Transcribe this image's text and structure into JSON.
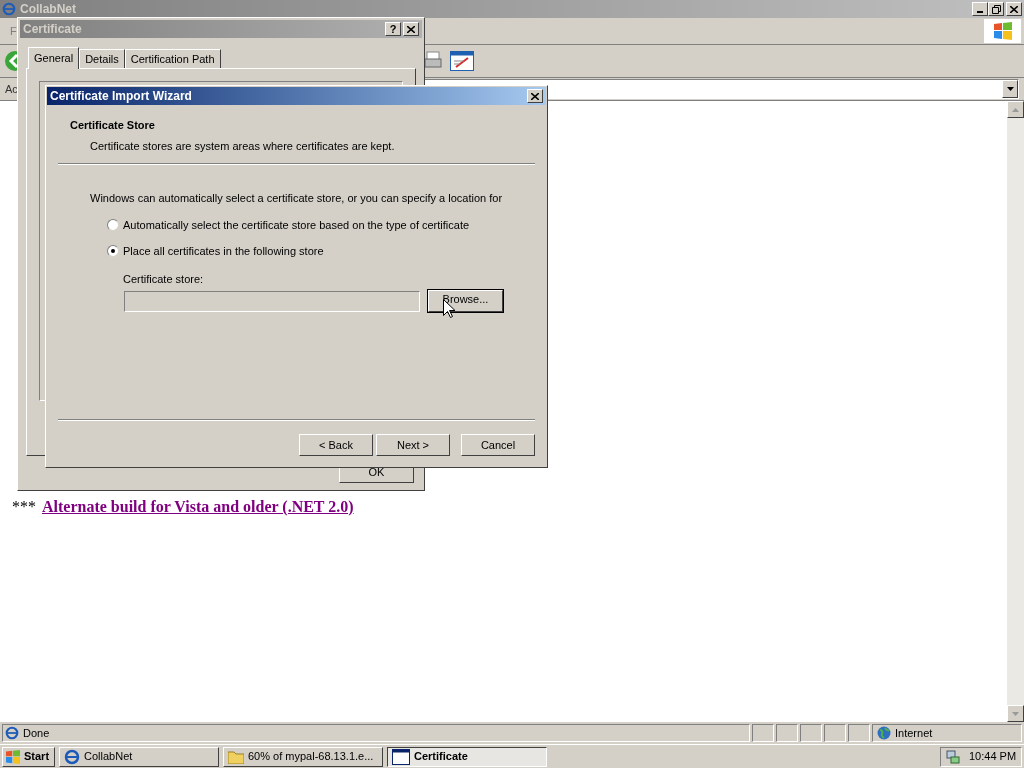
{
  "browser": {
    "title": "CollabNet",
    "menu_fragment": "F",
    "address_label": "Ac",
    "page": {
      "prefix": "***",
      "link": "Alternate build for Vista and older (.NET 2.0)"
    },
    "status": {
      "text": "Done",
      "zone": "Internet"
    }
  },
  "certificate_dialog": {
    "title": "Certificate",
    "help_button": "?",
    "tabs": [
      {
        "label": "General",
        "selected": true
      },
      {
        "label": "Details",
        "selected": false
      },
      {
        "label": "Certification Path",
        "selected": false
      }
    ],
    "ok_button": "OK"
  },
  "wizard": {
    "title": "Certificate Import Wizard",
    "heading": "Certificate Store",
    "subheading": "Certificate stores are system areas where certificates are kept.",
    "intro": "Windows can automatically select a certificate store, or you can specify a location for",
    "options": [
      {
        "label": "Automatically select the certificate store based on the type of certificate",
        "selected": false
      },
      {
        "label": "Place all certificates in the following store",
        "selected": true
      }
    ],
    "store_label": "Certificate store:",
    "store_field": {
      "disabled": true
    },
    "browse_button": "Browse...",
    "buttons": [
      "< Back",
      "Next >",
      "Cancel"
    ]
  },
  "taskbar": {
    "start": "Start",
    "tasks": [
      {
        "label": "CollabNet",
        "kind": "browser",
        "selected": false
      },
      {
        "label": "60% of mypal-68.13.1.e...",
        "kind": "folder",
        "selected": false
      },
      {
        "label": "Certificate",
        "kind": "window",
        "selected": true
      }
    ],
    "clock": "10:44 PM"
  }
}
